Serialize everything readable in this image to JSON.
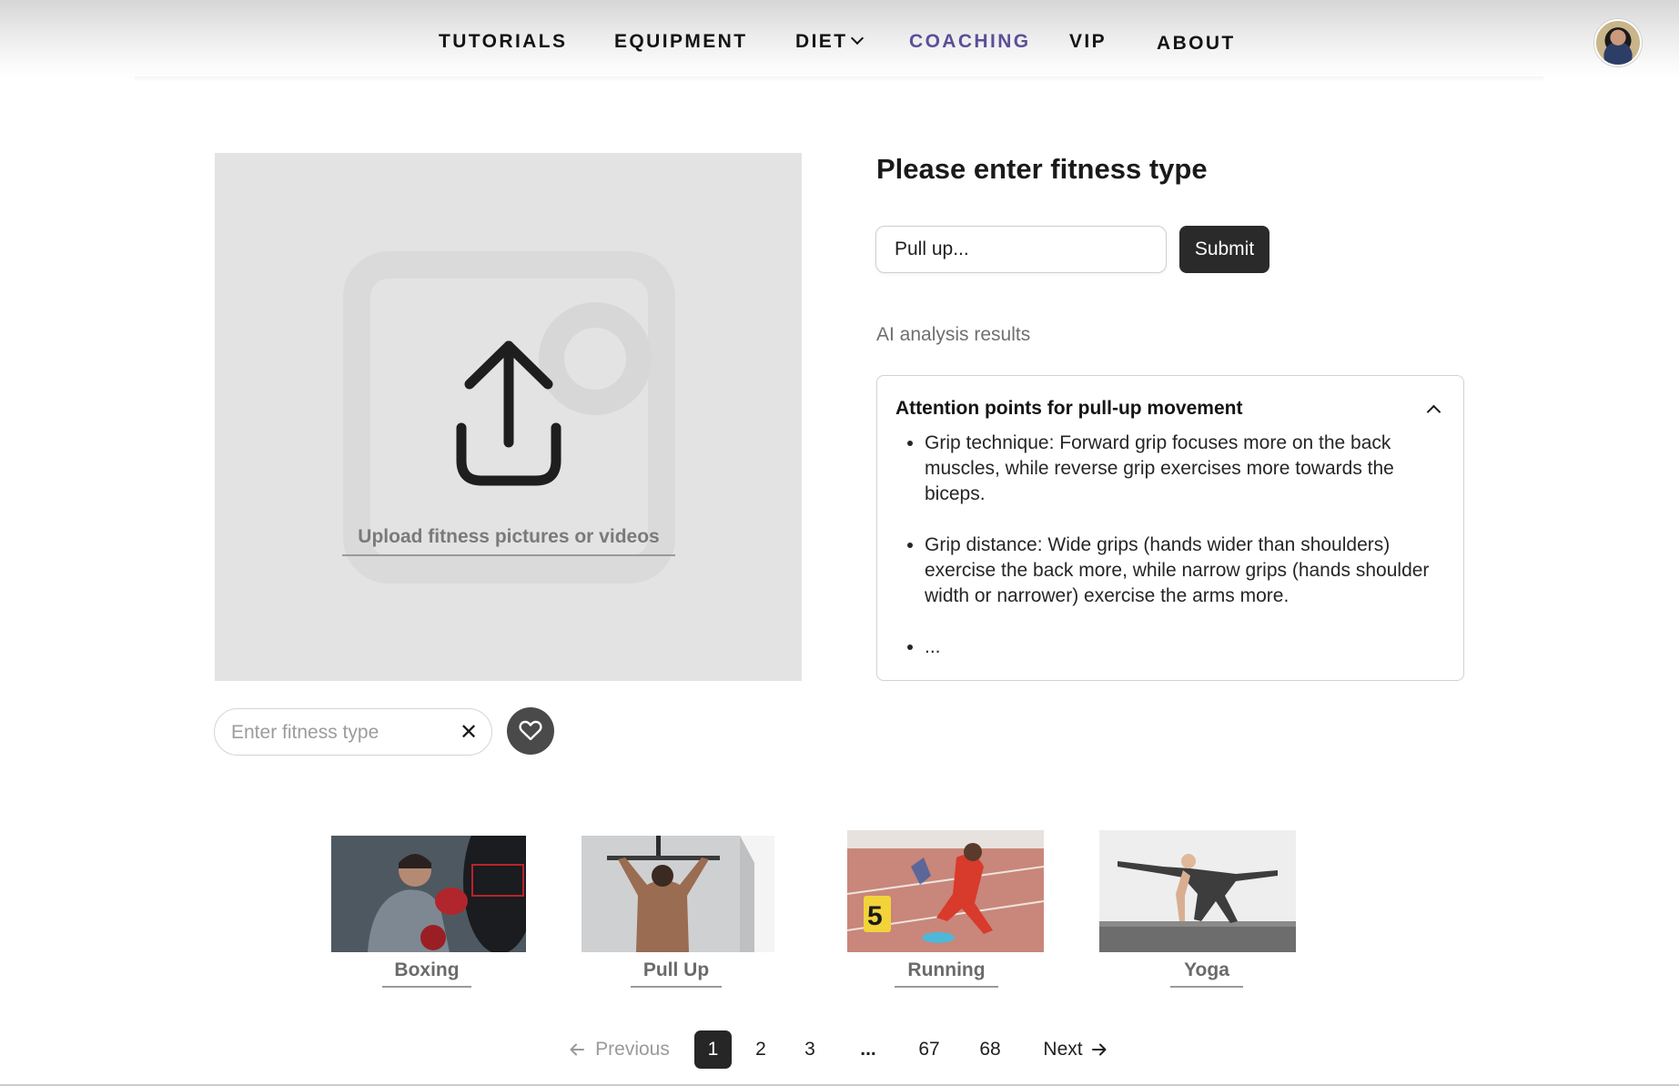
{
  "nav": {
    "items": [
      {
        "label": "TUTORIALS",
        "active": false
      },
      {
        "label": "EQUIPMENT",
        "active": false
      },
      {
        "label": "DIET",
        "active": false,
        "has_dropdown": true
      },
      {
        "label": "COACHING",
        "active": true
      },
      {
        "label": "VIP",
        "active": false
      },
      {
        "label": "ABOUT",
        "active": false
      }
    ],
    "active_color": "#5b4f9a"
  },
  "upload": {
    "label": "Upload fitness pictures or videos",
    "icon": "upload-icon"
  },
  "form": {
    "title": "Please enter fitness type",
    "input_value": "Pull up...",
    "submit_label": "Submit"
  },
  "results": {
    "section_label": "AI analysis results",
    "card_title": "Attention points for pull-up movement",
    "items": [
      "Grip technique: Forward grip focuses more on the back muscles, while reverse grip exercises more towards the biceps.",
      "Grip distance: Wide grips (hands wider than shoulders) exercise the back more, while narrow grips (hands shoulder width or narrower) exercise the arms more.",
      "..."
    ]
  },
  "search": {
    "placeholder": "Enter fitness type",
    "clear_icon": "close-icon",
    "favorite_icon": "heart-icon"
  },
  "categories": [
    {
      "label": "Boxing"
    },
    {
      "label": "Pull Up"
    },
    {
      "label": "Running"
    },
    {
      "label": "Yoga"
    }
  ],
  "pagination": {
    "previous": "Previous",
    "next": "Next",
    "pages": [
      "1",
      "2",
      "3",
      "...",
      "67",
      "68"
    ],
    "current": "1"
  }
}
